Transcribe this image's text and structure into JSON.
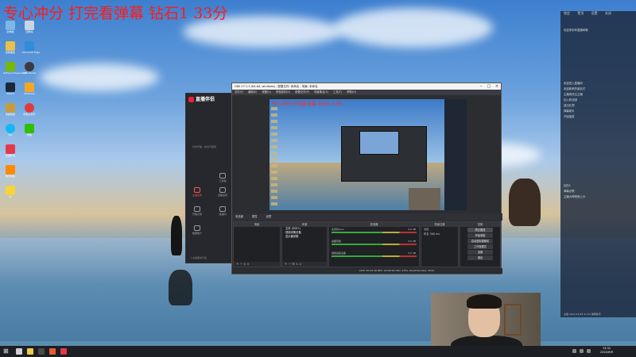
{
  "overlay": {
    "title": "专心冲分 打完看弹幕 钻石1 33分"
  },
  "desktop": {
    "icons": [
      {
        "label": "此电脑",
        "icon": "computer-icon",
        "color": "#7fb6e8"
      },
      {
        "label": "回收站",
        "icon": "recycle-bin-icon",
        "color": "#c8d6e4"
      },
      {
        "label": "控制面板",
        "icon": "control-panel-icon",
        "color": "#e8c04a"
      },
      {
        "label": "Microsoft Edge",
        "icon": "edge-icon",
        "color": "#2f8ed8"
      },
      {
        "label": "GeForce Experience",
        "icon": "nvidia-icon",
        "color": "#76b900"
      },
      {
        "label": "OBS Studio",
        "icon": "obs-icon",
        "color": "#3b3b3b"
      },
      {
        "label": "Steam",
        "icon": "steam-icon",
        "color": "#1b2838"
      },
      {
        "label": "WeGame",
        "icon": "wegame-icon",
        "color": "#f5a623"
      },
      {
        "label": "英雄联盟",
        "icon": "game-icon",
        "color": "#c89b3c"
      },
      {
        "label": "网易云音乐",
        "icon": "music-icon",
        "color": "#e03a3a"
      },
      {
        "label": "QQ",
        "icon": "qq-icon",
        "color": "#12b7f5"
      },
      {
        "label": "微信",
        "icon": "wechat-icon",
        "color": "#2dc100"
      },
      {
        "label": "直播伴侣",
        "icon": "live-icon",
        "color": "#e23a4a"
      },
      {
        "label": "腾讯视频",
        "icon": "video-icon",
        "color": "#ff8a00"
      },
      {
        "label": "YY",
        "icon": "yy-icon",
        "color": "#f7d33a"
      }
    ]
  },
  "assistant": {
    "brand": "直播伴侣",
    "muted_text": "暂未开播，快去开播吧",
    "buttons": [
      {
        "label": "工具箱",
        "icon": "toolbox-icon"
      },
      {
        "label": "主播任务",
        "icon": "task-icon"
      },
      {
        "label": "直播设置",
        "icon": "camera-icon"
      },
      {
        "label": "开播记录",
        "icon": "record-icon"
      },
      {
        "label": "直播间",
        "icon": "room-icon"
      },
      {
        "label": "数据统计",
        "icon": "chart-icon"
      }
    ],
    "footer_text": "小主播服务升级"
  },
  "obs": {
    "title": "OBS 27.1.3 (64-bit, windows) - 配置文件: 未命名 - 场景: 未命名",
    "menus": [
      "文件(F)",
      "编辑(E)",
      "视图(V)",
      "停靠部件(D)",
      "配置文件(P)",
      "场景集合(S)",
      "工具(T)",
      "帮助(H)"
    ],
    "preview_title": "专心冲分 打完看弹幕 钻石1 33分",
    "controls_bar": [
      "未选源",
      "属性",
      "滤镜"
    ],
    "panels": {
      "scenes": "场景",
      "sources": "来源",
      "mixer": "混音器",
      "transitions": "场景过渡",
      "controls": "控制"
    },
    "sources": [
      "文本 (GDI+)",
      "视频采集设备",
      "显示器采集"
    ],
    "mixer": [
      {
        "name": "麦克风/Aux",
        "level": "0.0 dB"
      },
      {
        "name": "桌面音频",
        "level": "0.0 dB"
      },
      {
        "name": "视频采集设备",
        "level": "0.0 dB"
      }
    ],
    "transitions": {
      "type": "淡出",
      "duration_label": "时长",
      "duration": "300 ms"
    },
    "control_buttons": [
      "停止推流",
      "开始录制",
      "启动虚拟摄像机",
      "工作室模式",
      "设置",
      "退出"
    ],
    "status": "LIVE: 00:42:16   REC: 00:00:00   CPU: 4.8%, 60.00 fps   kb/s: 2519"
  },
  "danmaku": {
    "toolbar": [
      "锁定",
      "置顶",
      "设置",
      "关闭"
    ],
    "messages": [
      "欢迎来到本直播间哦",
      "欢迎进入直播间",
      "欢迎新来的朋友们",
      "主播请关注主播",
      "加入粉丝团",
      "送出礼物",
      "弹幕助手",
      "开始抽奖",
      "钻石1",
      "弹幕点歌",
      "主播大神带我上分"
    ],
    "footer": "主播 2021/11/28 21:03 弹幕助手"
  },
  "taskbar": {
    "time": "13:31",
    "date": "2022/8/9",
    "apps": [
      {
        "icon": "search-icon",
        "color": "#d0d0d0"
      },
      {
        "icon": "file-explorer-icon",
        "color": "#f2c94c"
      },
      {
        "icon": "obs-taskbar-icon",
        "color": "#4a4a4a"
      },
      {
        "icon": "browser-icon",
        "color": "#e95b2f"
      },
      {
        "icon": "live-taskbar-icon",
        "color": "#e23a4a"
      }
    ]
  }
}
